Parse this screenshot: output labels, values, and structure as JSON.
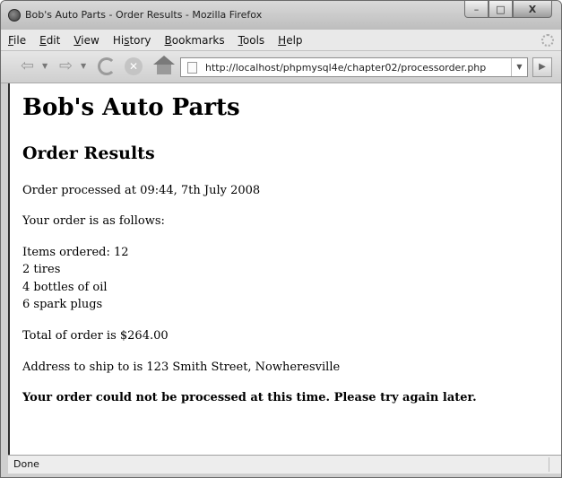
{
  "window": {
    "title": "Bob's Auto Parts - Order Results - Mozilla Firefox",
    "controls": {
      "minimize": "–",
      "maximize": "□",
      "close": "X"
    }
  },
  "menu": {
    "items": [
      {
        "accel": "F",
        "rest": "ile"
      },
      {
        "accel": "E",
        "rest": "dit"
      },
      {
        "accel": "V",
        "rest": "iew"
      },
      {
        "pre": "Hi",
        "accel": "s",
        "rest": "tory"
      },
      {
        "accel": "B",
        "rest": "ookmarks"
      },
      {
        "accel": "T",
        "rest": "ools"
      },
      {
        "accel": "H",
        "rest": "elp"
      }
    ]
  },
  "toolbar": {
    "url": "http://localhost/phpmysql4e/chapter02/processorder.php",
    "icons": {
      "back": "back-arrow-icon",
      "forward": "forward-arrow-icon",
      "reload": "reload-icon",
      "stop": "stop-icon",
      "home": "home-icon",
      "go": "go-arrow-icon"
    }
  },
  "page": {
    "heading": "Bob's Auto Parts",
    "subheading": "Order Results",
    "processed_at": "Order processed at 09:44, 7th July 2008",
    "order_intro": "Your order is as follows:",
    "items_ordered": "Items ordered: 12",
    "lines": [
      "2 tires",
      "4 bottles of oil",
      "6 spark plugs"
    ],
    "total": "Total of order is $264.00",
    "address": "Address to ship to is 123 Smith Street, Nowheresville",
    "error": "Your order could not be processed at this time. Please try again later."
  },
  "status": {
    "text": "Done"
  }
}
